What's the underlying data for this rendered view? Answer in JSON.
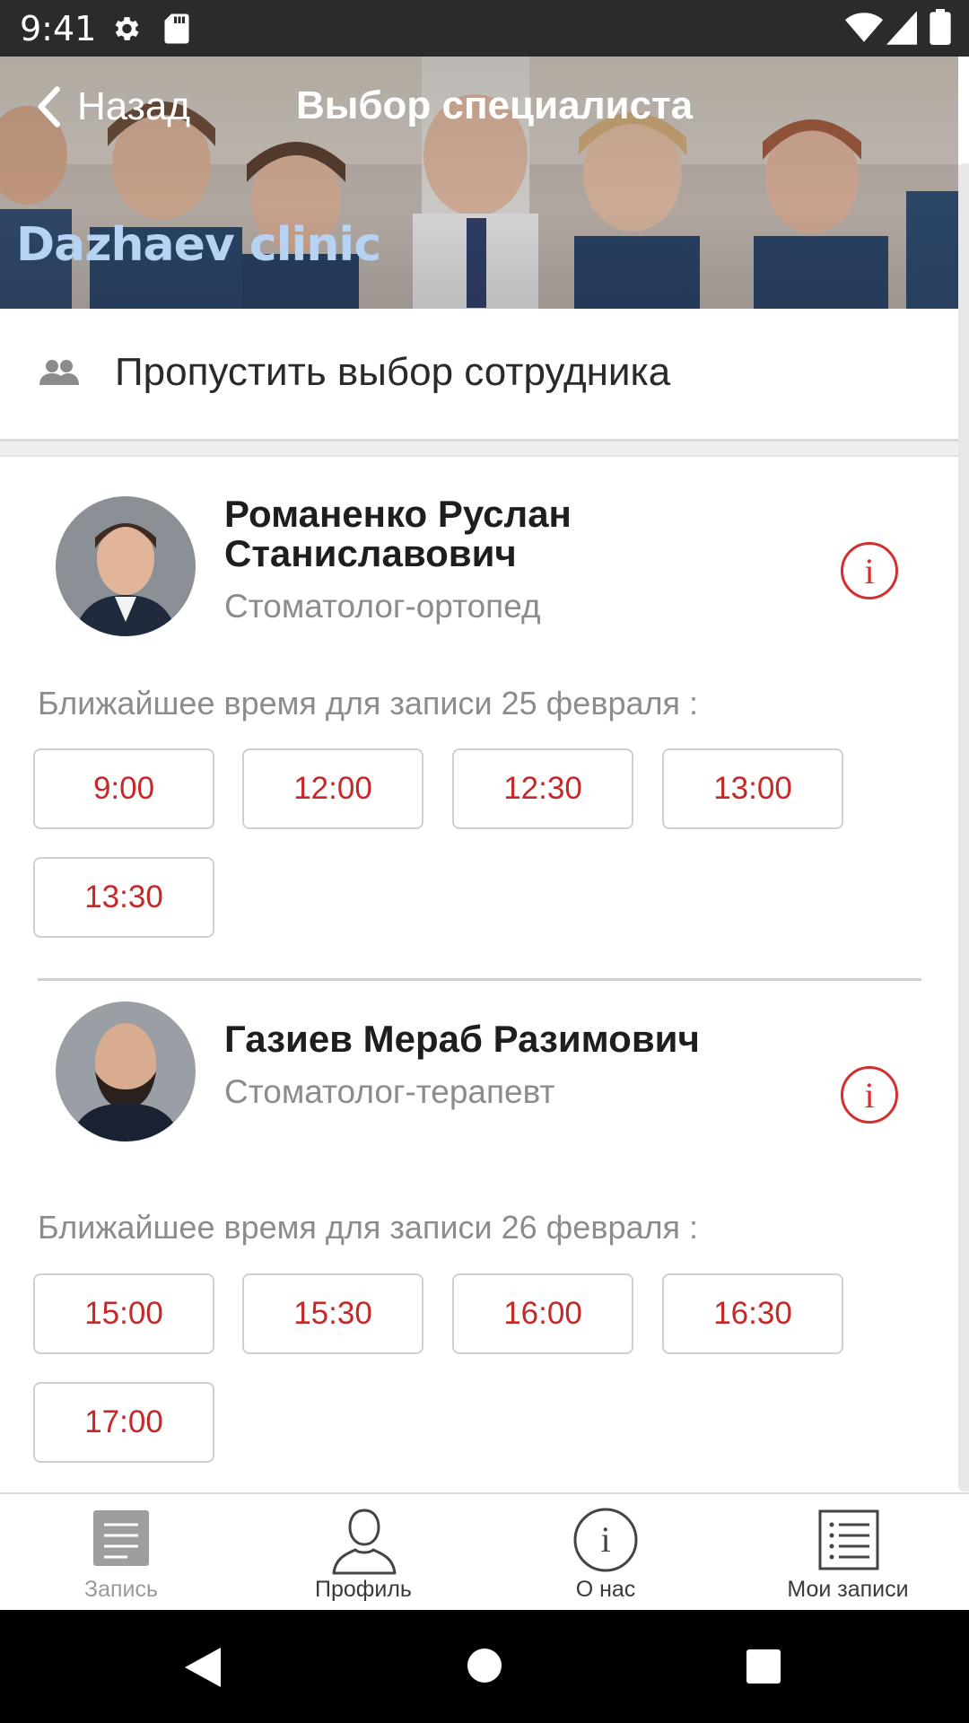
{
  "status_bar": {
    "time": "9:41"
  },
  "header": {
    "back_label": "Назад",
    "title": "Выбор специалиста",
    "clinic_name": "Dazhaev clinic"
  },
  "skip": {
    "label": "Пропустить выбор сотрудника"
  },
  "specialists": [
    {
      "name_line1": "Романенко Руслан",
      "name_line2": "Станиславович",
      "role": "Стоматолог-ортопед",
      "nearest_label": "Ближайшее время для записи 25 февраля :",
      "slots": [
        "9:00",
        "12:00",
        "12:30",
        "13:00",
        "13:30"
      ]
    },
    {
      "name_line1": "Газиев Мераб Разимович",
      "name_line2": "",
      "role": "Стоматолог-терапевт",
      "nearest_label": "Ближайшее время для записи 26 февраля :",
      "slots": [
        "15:00",
        "15:30",
        "16:00",
        "16:30",
        "17:00"
      ]
    }
  ],
  "bottom_nav": {
    "items": [
      {
        "label": "Запись",
        "icon": "document-icon",
        "active": true
      },
      {
        "label": "Профиль",
        "icon": "person-icon",
        "active": false
      },
      {
        "label": "О нас",
        "icon": "info-icon",
        "active": false
      },
      {
        "label": "Мои записи",
        "icon": "list-icon",
        "active": false
      }
    ]
  },
  "colors": {
    "accent_red": "#c62828",
    "clinic_name": "#b7d3f4",
    "status_bar": "#2b2b2b"
  }
}
